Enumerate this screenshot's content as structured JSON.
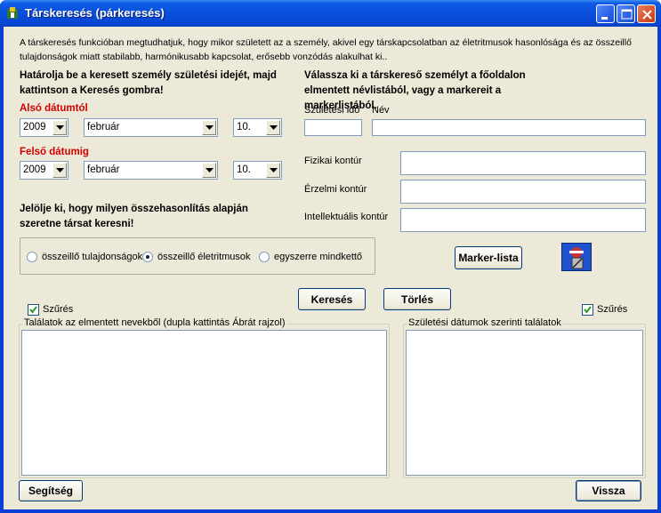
{
  "window": {
    "title": "Társkeresés (párkeresés)"
  },
  "intro_text": "A társkeresés funkcióban megtudhatjuk, hogy mikor született az a személy, akivel egy társkapcsolatban az életritmusok hasonlósága és az összeillő tulajdonságok miatt stabilabb, harmónikusabb kapcsolat, erősebb vonzódás alakulhat ki..",
  "left_instructions": "Határolja be a keresett személy születési idejét, majd kattintson a Keresés gombra!",
  "right_instructions": "Válassza ki a társkereső személyt a főoldalon elmentett névlistából, vagy a markereit a markerlistából.",
  "lower_date": {
    "label": "Alsó dátumtól",
    "year": "2009",
    "month": "február",
    "day": "10."
  },
  "upper_date": {
    "label": "Felső dátumig",
    "year": "2009",
    "month": "február",
    "day": "10."
  },
  "birth_field_label": "Születési idő",
  "name_field_label": "Név",
  "birth_value": "",
  "name_value": "",
  "contours": {
    "physical_label": "Fizikai kontúr",
    "emotional_label": "Érzelmi kontúr",
    "intellectual_label": "Intellektuális kontúr",
    "physical_value": "",
    "emotional_value": "",
    "intellectual_value": ""
  },
  "comparison_prompt": "Jelölje ki, hogy milyen összehasonlítás alapján szeretne társat keresni!",
  "radios": [
    {
      "label": "összeillő tulajdonságok",
      "checked": false
    },
    {
      "label": "összeillő életritmusok",
      "checked": true
    },
    {
      "label": "egyszerre mindkettő",
      "checked": false
    }
  ],
  "buttons": {
    "marker_list": "Marker-lista",
    "search": "Keresés",
    "clear": "Törlés",
    "help": "Segítség",
    "back": "Vissza"
  },
  "filter_left": {
    "label": "Szűrés",
    "checked": true
  },
  "filter_right": {
    "label": "Szűrés",
    "checked": true
  },
  "list_left_title": "Találatok az elmentett nevekből (dupla kattintás Ábrát rajzol)",
  "list_right_title": "Születési dátumok szerinti találatok",
  "icons": {
    "app": "app-icon",
    "marker": "marker-figure-icon",
    "minimize": "minimize-icon",
    "maximize": "maximize-icon",
    "close": "close-icon"
  },
  "colors": {
    "title_bar": "#0a4fdc",
    "date_label_red": "#d40000",
    "client_bg": "#ece9d8"
  }
}
